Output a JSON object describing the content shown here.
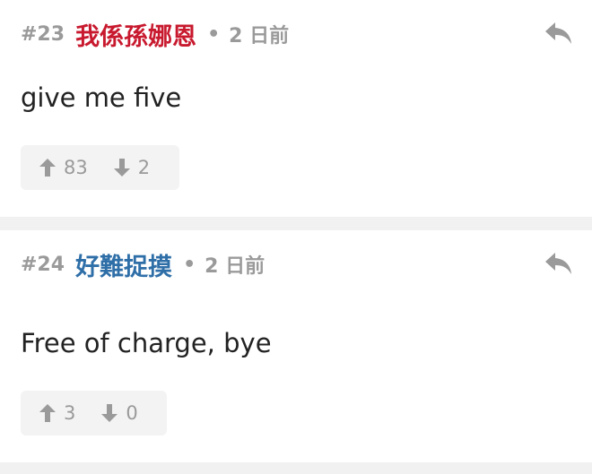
{
  "posts": [
    {
      "floor": "#23",
      "username": "我係孫娜恩",
      "username_color": "#c8192e",
      "separator": "•",
      "time": "2 日前",
      "content": "give me five",
      "upvotes": "83",
      "downvotes": "2"
    },
    {
      "floor": "#24",
      "username": "好難捉摸",
      "username_color": "#2f6fa8",
      "separator": "•",
      "time": "2 日前",
      "content": "Free of charge, bye",
      "upvotes": "3",
      "downvotes": "0"
    }
  ],
  "colors": {
    "meta_gray": "#9a9a9a",
    "vote_bg": "#f3f3f3",
    "separator_bg": "#f1f1f1"
  },
  "icons": {
    "reply": "reply-icon",
    "upvote": "arrow-up-icon",
    "downvote": "arrow-down-icon"
  }
}
